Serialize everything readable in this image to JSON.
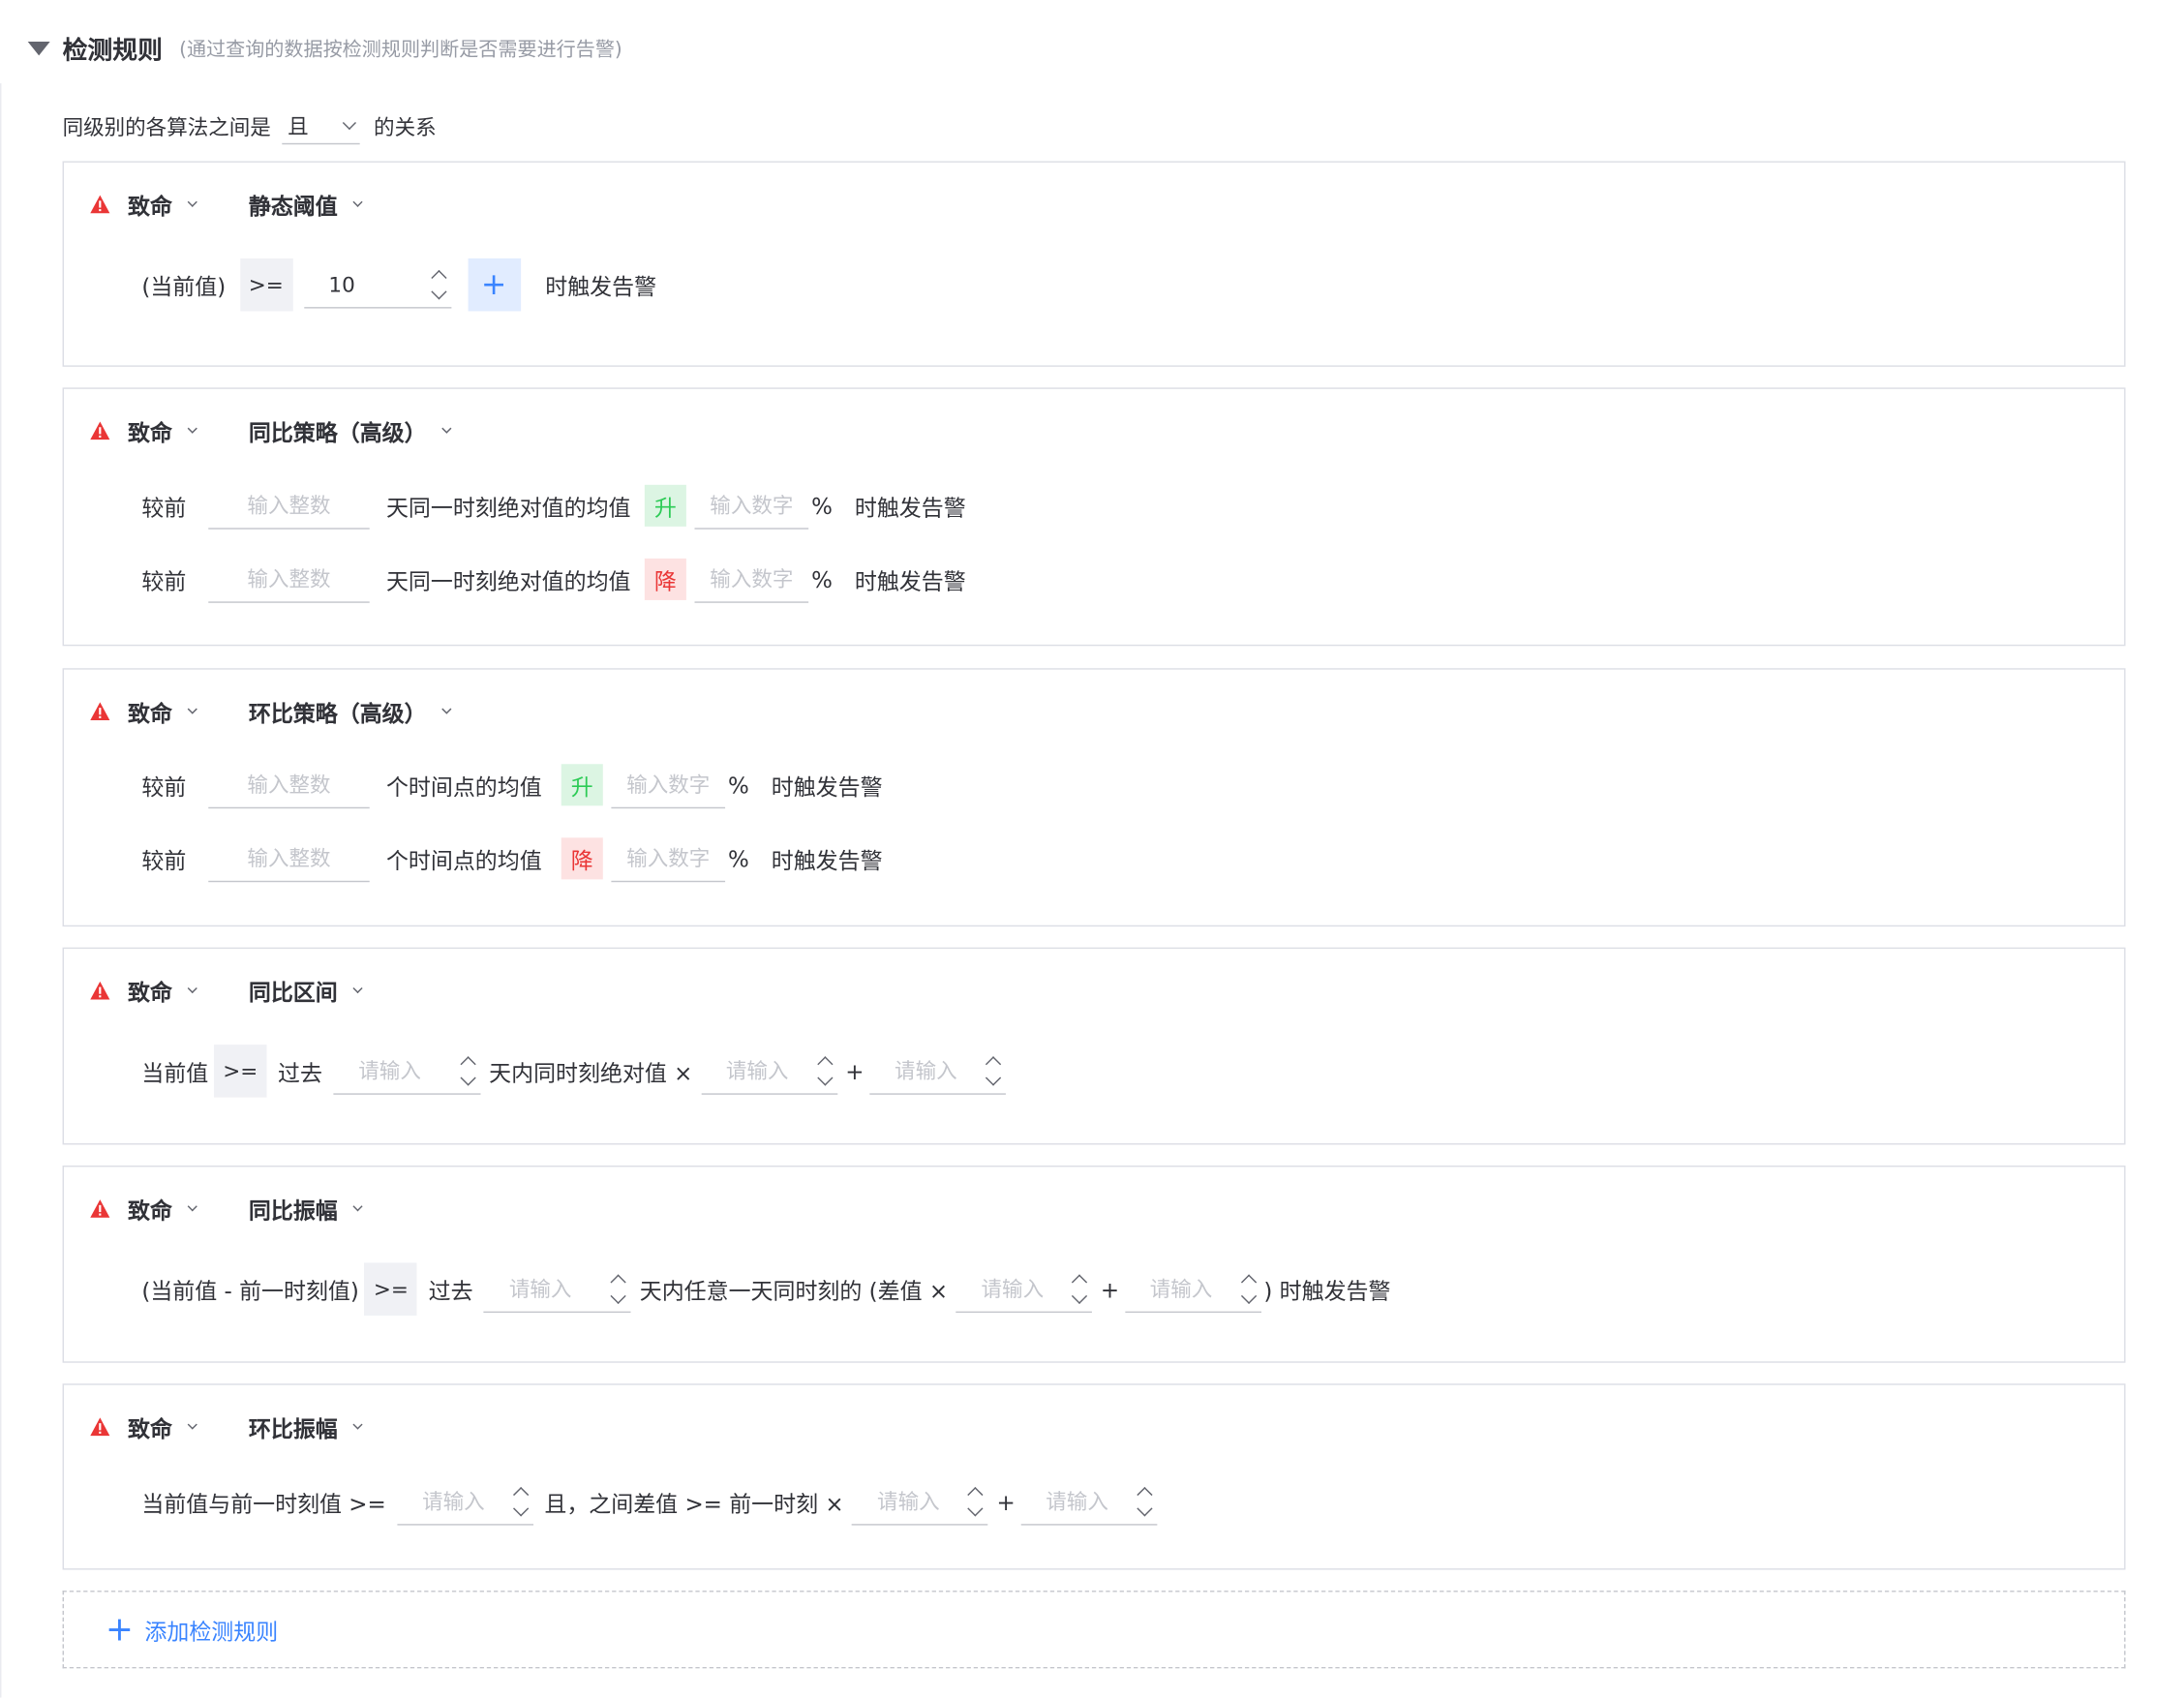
{
  "section": {
    "title": "检测规则",
    "desc": "(通过查询的数据按检测规则判断是否需要进行告警)"
  },
  "relation": {
    "prefix": "同级别的各算法之间是",
    "value": "且",
    "suffix": "的关系"
  },
  "colors": {
    "accent": "#3a84ff",
    "danger": "#ea3636",
    "success": "#2dcb56"
  },
  "cards": {
    "static": {
      "level": "致命",
      "algo": "静态阈值",
      "current": "(当前值)",
      "op": ">=",
      "value": "10",
      "plus": "+",
      "suffix": "时触发告警"
    },
    "yoy_adv": {
      "level": "致命",
      "algo": "同比策略（高级）",
      "rows": [
        {
          "prefix": "较前",
          "days_ph": "输入整数",
          "mid": "天同一时刻绝对值的均值",
          "dir": "升",
          "num_ph": "输入数字",
          "pct": "%",
          "suffix": "时触发告警"
        },
        {
          "prefix": "较前",
          "days_ph": "输入整数",
          "mid": "天同一时刻绝对值的均值",
          "dir": "降",
          "num_ph": "输入数字",
          "pct": "%",
          "suffix": "时触发告警"
        }
      ]
    },
    "mom_adv": {
      "level": "致命",
      "algo": "环比策略（高级）",
      "rows": [
        {
          "prefix": "较前",
          "days_ph": "输入整数",
          "mid": "个时间点的均值",
          "dir": "升",
          "num_ph": "输入数字",
          "pct": "%",
          "suffix": "时触发告警"
        },
        {
          "prefix": "较前",
          "days_ph": "输入整数",
          "mid": "个时间点的均值",
          "dir": "降",
          "num_ph": "输入数字",
          "pct": "%",
          "suffix": "时触发告警"
        }
      ]
    },
    "yoy_range": {
      "level": "致命",
      "algo": "同比区间",
      "current": "当前值",
      "op": ">=",
      "past": "过去",
      "ph1": "请输入",
      "mid": "天内同时刻绝对值 ×",
      "ph2": "请输入",
      "plus": "+",
      "ph3": "请输入"
    },
    "yoy_amp": {
      "level": "致命",
      "algo": "同比振幅",
      "current": "(当前值 - 前一时刻值)",
      "op": ">=",
      "past": "过去",
      "ph1": "请输入",
      "mid": "天内任意一天同时刻的 (差值 ×",
      "ph2": "请输入",
      "plus": "+",
      "ph3": "请输入",
      "suffix": ") 时触发告警"
    },
    "mom_amp": {
      "level": "致命",
      "algo": "环比振幅",
      "current": "当前值与前一时刻值 >=",
      "ph1": "请输入",
      "mid": "且，之间差值 >= 前一时刻 ×",
      "ph2": "请输入",
      "plus": "+",
      "ph3": "请输入"
    }
  },
  "add_rule": "添加检测规则"
}
